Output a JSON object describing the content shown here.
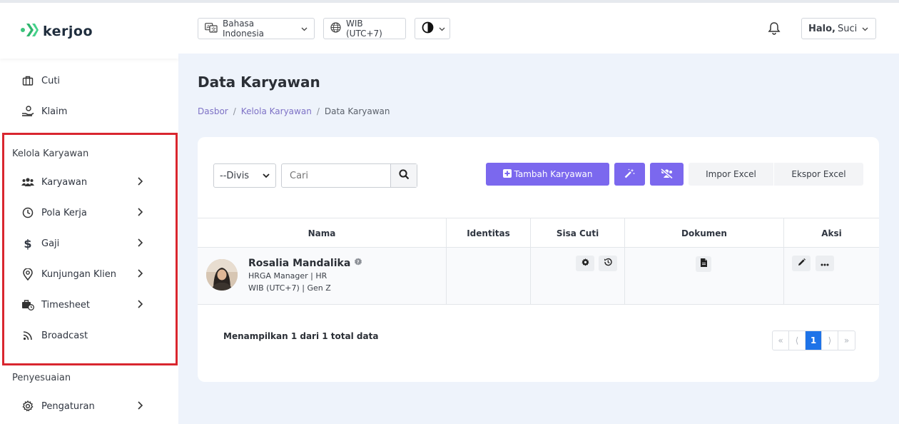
{
  "app": {
    "logo_text": "kerjoo"
  },
  "header": {
    "language": "Bahasa Indonesia",
    "timezone": "WIB (UTC+7)",
    "greeting_bold": "Halo,",
    "user_name": "Suci"
  },
  "sidebar": {
    "top_items": [
      {
        "label": "Cuti",
        "icon": "briefcase-icon"
      },
      {
        "label": "Klaim",
        "icon": "hand-money-icon"
      }
    ],
    "section_manage": "Kelola Karyawan",
    "manage_items": [
      {
        "label": "Karyawan",
        "icon": "users-icon"
      },
      {
        "label": "Pola Kerja",
        "icon": "clock-icon"
      },
      {
        "label": "Gaji",
        "icon": "dollar-icon"
      },
      {
        "label": "Kunjungan Klien",
        "icon": "location-pin-icon"
      },
      {
        "label": "Timesheet",
        "icon": "briefcase-clock-icon"
      },
      {
        "label": "Broadcast",
        "icon": "rss-icon"
      }
    ],
    "section_settings": "Penyesuaian",
    "settings_items": [
      {
        "label": "Pengaturan",
        "icon": "gear-icon"
      }
    ]
  },
  "page": {
    "title": "Data Karyawan",
    "breadcrumb": [
      "Dasbor",
      "Kelola Karyawan",
      "Data Karyawan"
    ]
  },
  "toolbar": {
    "division_select": "--Divis",
    "search_placeholder": "Cari",
    "add_button": "Tambah Karyawan",
    "import_button": "Impor Excel",
    "export_button": "Ekspor Excel"
  },
  "table": {
    "columns": [
      "Nama",
      "Identitas",
      "Sisa Cuti",
      "Dokumen",
      "Aksi"
    ],
    "rows": [
      {
        "name": "Rosalia Mandalika",
        "position": "HRGA Manager | HR",
        "meta": "WIB (UTC+7) | Gen Z",
        "identity": ""
      }
    ]
  },
  "footer": {
    "summary": "Menampilkan 1 dari 1 total data",
    "pagination": {
      "first": "«",
      "prev": "⟨",
      "current": "1",
      "next": "⟩",
      "last": "»"
    }
  },
  "colors": {
    "accent": "#7b68ee",
    "highlight_border": "#d9262f",
    "page_active": "#1e73e8"
  }
}
